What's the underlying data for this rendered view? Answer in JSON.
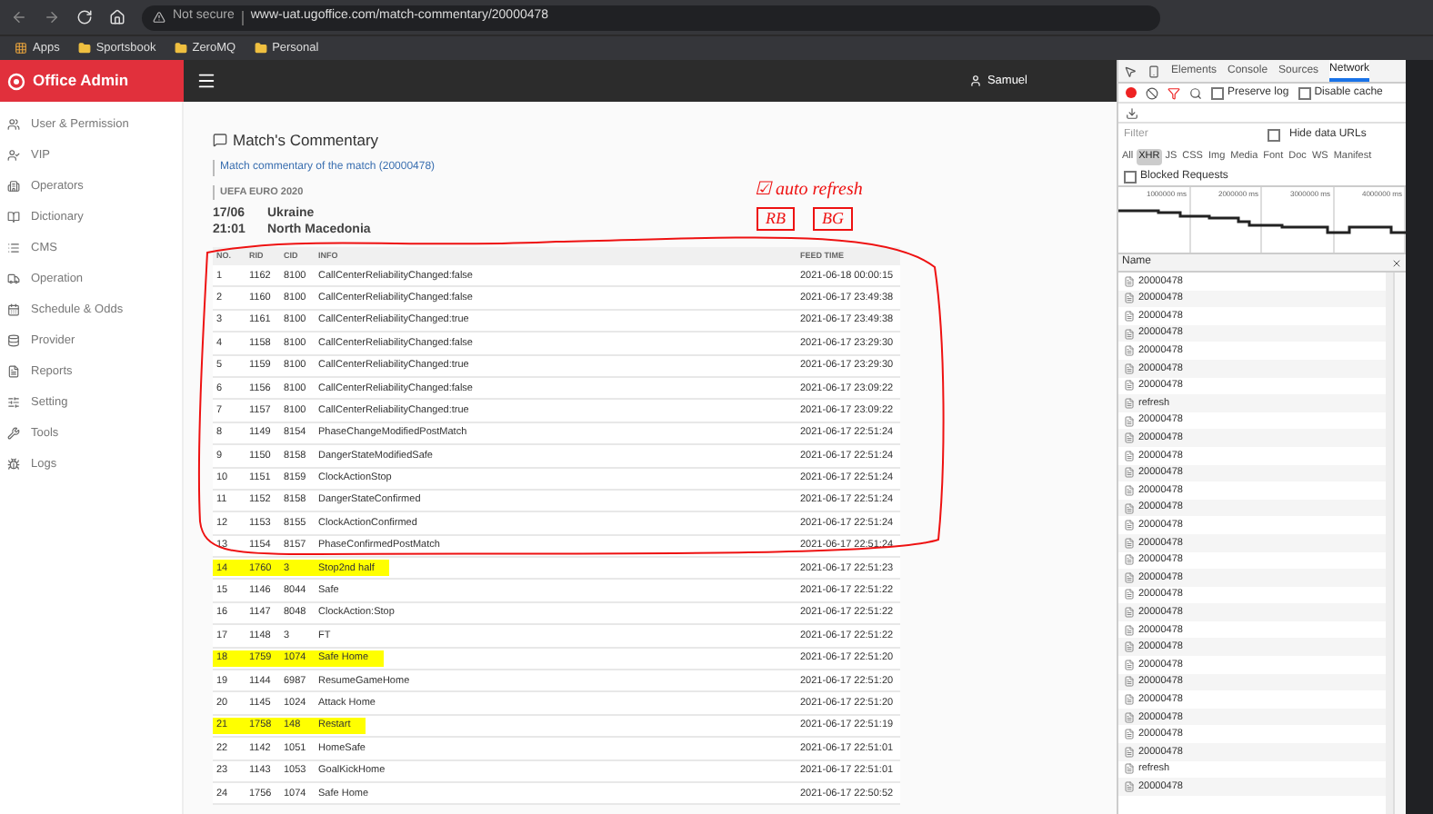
{
  "browser": {
    "security": "Not secure",
    "url": "www-uat.ugoffice.com/match-commentary/20000478",
    "bookmarks": [
      "Apps",
      "Sportsbook",
      "ZeroMQ",
      "Personal"
    ]
  },
  "app": {
    "title": "Office Admin",
    "user": "Samuel"
  },
  "sidebar": {
    "items": [
      {
        "label": "User & Permission",
        "kind": "users"
      },
      {
        "label": "VIP",
        "kind": "vip"
      },
      {
        "label": "Operators",
        "kind": "operators"
      },
      {
        "label": "Dictionary",
        "kind": "dictionary"
      },
      {
        "label": "CMS",
        "kind": "cms"
      },
      {
        "label": "Operation",
        "kind": "operation"
      },
      {
        "label": "Schedule & Odds",
        "kind": "schedule"
      },
      {
        "label": "Provider",
        "kind": "provider"
      },
      {
        "label": "Reports",
        "kind": "reports"
      },
      {
        "label": "Setting",
        "kind": "setting"
      },
      {
        "label": "Tools",
        "kind": "tools"
      },
      {
        "label": "Logs",
        "kind": "logs"
      }
    ]
  },
  "page": {
    "title": "Match's Commentary",
    "subtitle": "Match commentary of the match (20000478)",
    "competition": "UEFA EURO 2020",
    "date": "17/06",
    "time": "21:01",
    "home": "Ukraine",
    "away": "North Macedonia"
  },
  "table": {
    "columns": [
      "NO.",
      "RID",
      "CID",
      "INFO",
      "FEED TIME"
    ],
    "rows": [
      {
        "cells": [
          "1",
          "1162",
          "8100",
          "CallCenterReliabilityChanged:false",
          "2021-06-18 00:00:15"
        ],
        "highlighted": false
      },
      {
        "cells": [
          "2",
          "1160",
          "8100",
          "CallCenterReliabilityChanged:false",
          "2021-06-17 23:49:38"
        ],
        "highlighted": false
      },
      {
        "cells": [
          "3",
          "1161",
          "8100",
          "CallCenterReliabilityChanged:true",
          "2021-06-17 23:49:38"
        ],
        "highlighted": false
      },
      {
        "cells": [
          "4",
          "1158",
          "8100",
          "CallCenterReliabilityChanged:false",
          "2021-06-17 23:29:30"
        ],
        "highlighted": false
      },
      {
        "cells": [
          "5",
          "1159",
          "8100",
          "CallCenterReliabilityChanged:true",
          "2021-06-17 23:29:30"
        ],
        "highlighted": false
      },
      {
        "cells": [
          "6",
          "1156",
          "8100",
          "CallCenterReliabilityChanged:false",
          "2021-06-17 23:09:22"
        ],
        "highlighted": false
      },
      {
        "cells": [
          "7",
          "1157",
          "8100",
          "CallCenterReliabilityChanged:true",
          "2021-06-17 23:09:22"
        ],
        "highlighted": false
      },
      {
        "cells": [
          "8",
          "1149",
          "8154",
          "PhaseChangeModifiedPostMatch",
          "2021-06-17 22:51:24"
        ],
        "highlighted": false
      },
      {
        "cells": [
          "9",
          "1150",
          "8158",
          "DangerStateModifiedSafe",
          "2021-06-17 22:51:24"
        ],
        "highlighted": false
      },
      {
        "cells": [
          "10",
          "1151",
          "8159",
          "ClockActionStop",
          "2021-06-17 22:51:24"
        ],
        "highlighted": false
      },
      {
        "cells": [
          "11",
          "1152",
          "8158",
          "DangerStateConfirmed",
          "2021-06-17 22:51:24"
        ],
        "highlighted": false
      },
      {
        "cells": [
          "12",
          "1153",
          "8155",
          "ClockActionConfirmed",
          "2021-06-17 22:51:24"
        ],
        "highlighted": false
      },
      {
        "cells": [
          "13",
          "1154",
          "8157",
          "PhaseConfirmedPostMatch",
          "2021-06-17 22:51:24"
        ],
        "highlighted": false
      },
      {
        "cells": [
          "14",
          "1760",
          "3",
          "Stop2nd half",
          "2021-06-17 22:51:23"
        ],
        "highlighted": true
      },
      {
        "cells": [
          "15",
          "1146",
          "8044",
          "Safe",
          "2021-06-17 22:51:22"
        ],
        "highlighted": false
      },
      {
        "cells": [
          "16",
          "1147",
          "8048",
          "ClockAction:Stop",
          "2021-06-17 22:51:22"
        ],
        "highlighted": false
      },
      {
        "cells": [
          "17",
          "1148",
          "3",
          "FT",
          "2021-06-17 22:51:22"
        ],
        "highlighted": false
      },
      {
        "cells": [
          "18",
          "1759",
          "1074",
          "Safe Home",
          "2021-06-17 22:51:20"
        ],
        "highlighted": true
      },
      {
        "cells": [
          "19",
          "1144",
          "6987",
          "ResumeGameHome",
          "2021-06-17 22:51:20"
        ],
        "highlighted": false
      },
      {
        "cells": [
          "20",
          "1145",
          "1024",
          "Attack Home",
          "2021-06-17 22:51:20"
        ],
        "highlighted": false
      },
      {
        "cells": [
          "21",
          "1758",
          "148",
          "Restart",
          "2021-06-17 22:51:19"
        ],
        "highlighted": true
      },
      {
        "cells": [
          "22",
          "1142",
          "1051",
          "HomeSafe",
          "2021-06-17 22:51:01"
        ],
        "highlighted": false
      },
      {
        "cells": [
          "23",
          "1143",
          "1053",
          "GoalKickHome",
          "2021-06-17 22:51:01"
        ],
        "highlighted": false
      },
      {
        "cells": [
          "24",
          "1756",
          "1074",
          "Safe Home",
          "2021-06-17 22:50:52"
        ],
        "highlighted": false
      }
    ]
  },
  "annotation": {
    "note": "☑ auto refresh",
    "tags": [
      "RB",
      "BG"
    ]
  },
  "devtools": {
    "tabs": [
      {
        "label": "Elements",
        "selected": false
      },
      {
        "label": "Console",
        "selected": false
      },
      {
        "label": "Sources",
        "selected": false
      },
      {
        "label": "Network",
        "selected": true
      }
    ],
    "options": [
      {
        "label": "Preserve log",
        "checked": false
      },
      {
        "label": "Disable cache",
        "checked": false
      }
    ],
    "filter_placeholder": "Filter",
    "hide_data_urls": {
      "label": "Hide data URLs",
      "checked": false
    },
    "types": [
      {
        "label": "All",
        "selected": false
      },
      {
        "label": "XHR",
        "selected": true
      },
      {
        "label": "JS",
        "selected": false
      },
      {
        "label": "CSS",
        "selected": false
      },
      {
        "label": "Img",
        "selected": false
      },
      {
        "label": "Media",
        "selected": false
      },
      {
        "label": "Font",
        "selected": false
      },
      {
        "label": "Doc",
        "selected": false
      },
      {
        "label": "WS",
        "selected": false
      },
      {
        "label": "Manifest",
        "selected": false
      }
    ],
    "blocked_requests": {
      "label": "Blocked Requests",
      "checked": false
    },
    "timeline_ticks": [
      "1000000 ms",
      "2000000 ms",
      "3000000 ms",
      "4000000 ms"
    ],
    "name_header": "Name",
    "requests": [
      "20000478",
      "20000478",
      "20000478",
      "20000478",
      "20000478",
      "20000478",
      "20000478",
      "refresh",
      "20000478",
      "20000478",
      "20000478",
      "20000478",
      "20000478",
      "20000478",
      "20000478",
      "20000478",
      "20000478",
      "20000478",
      "20000478",
      "20000478",
      "20000478",
      "20000478",
      "20000478",
      "20000478",
      "20000478",
      "20000478",
      "20000478",
      "20000478",
      "refresh",
      "20000478"
    ]
  }
}
